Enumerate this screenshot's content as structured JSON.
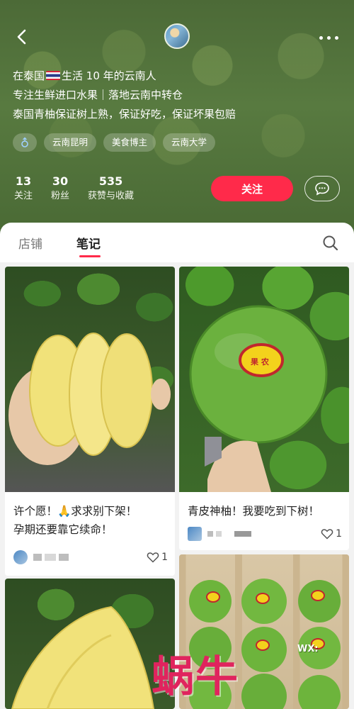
{
  "header": {
    "bio": [
      {
        "before": "在泰国",
        "flag": true,
        "after": "生活 10 年的云南人"
      },
      {
        "before": "专注生鲜进口水果｜落地云南中转仓",
        "flag": false,
        "after": ""
      },
      {
        "before": "泰国青柚保证树上熟，保证好吃，保证坏果包赔",
        "flag": false,
        "after": ""
      }
    ],
    "tags": [
      "云南昆明",
      "美食博主",
      "云南大学"
    ],
    "stats": [
      {
        "num": "13",
        "label": "关注"
      },
      {
        "num": "30",
        "label": "粉丝"
      },
      {
        "num": "535",
        "label": "获赞与收藏"
      }
    ],
    "follow_label": "关注"
  },
  "tabs": {
    "shop": "店铺",
    "notes": "笔记"
  },
  "feed": [
    {
      "title_line1": "许个愿！🙏求求别下架！",
      "title_line2": "孕期还要靠它续命！",
      "likes": "1"
    },
    {
      "title_line1": "青皮神柚！我要吃到下树！",
      "title_line2": "",
      "likes": "1"
    }
  ],
  "fruit_label": "果 农",
  "watermark": {
    "text": "蜗牛",
    "sub": "WX:"
  },
  "colors": {
    "accent": "#ff2a4a",
    "header_bg": "#4c6a37"
  }
}
